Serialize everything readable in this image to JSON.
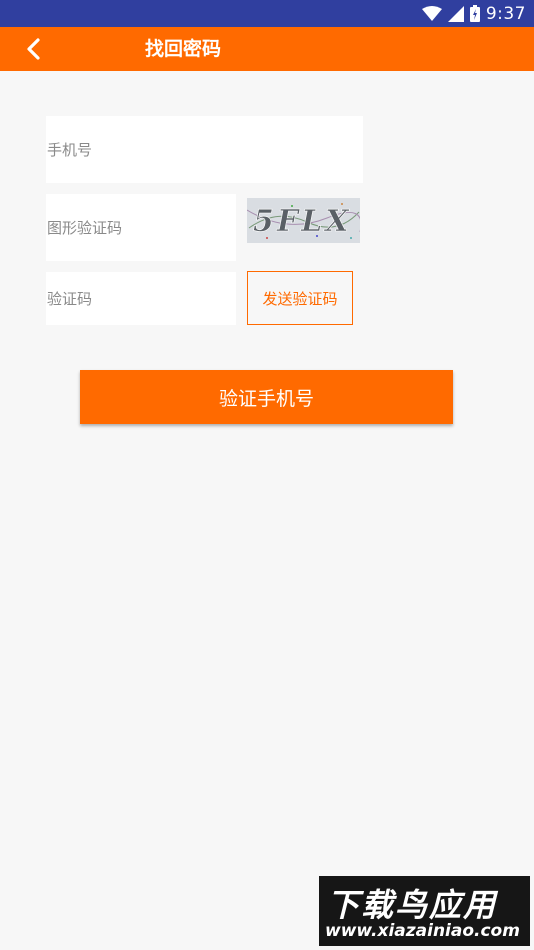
{
  "status_bar": {
    "time": "9:37",
    "icons": [
      "wifi-icon",
      "signal-icon",
      "battery-icon"
    ]
  },
  "header": {
    "title": "找回密码",
    "back_icon": "chevron-left-icon"
  },
  "form": {
    "phone_placeholder": "手机号",
    "image_captcha_placeholder": "图形验证码",
    "captcha_text": "5FLX",
    "sms_code_placeholder": "验证码",
    "send_code_label": "发送验证码",
    "verify_label": "验证手机号"
  },
  "watermark": {
    "name": "下载鸟应用",
    "url": "www.xiazainiao.com"
  },
  "colors": {
    "accent": "#ff6a00",
    "status_bar": "#303f9f",
    "background": "#f7f7f7"
  }
}
